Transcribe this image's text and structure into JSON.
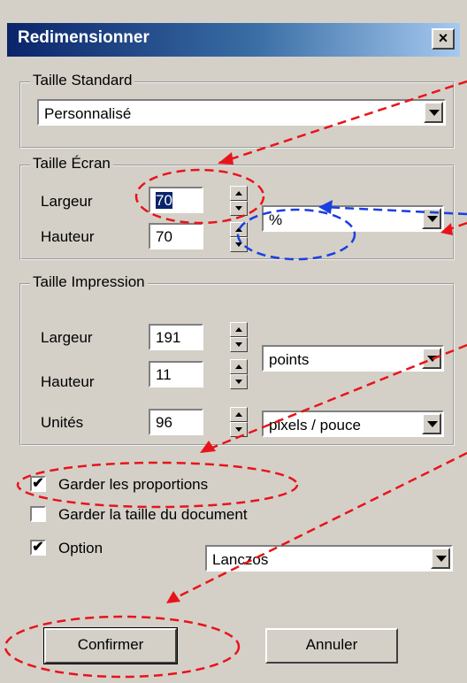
{
  "window": {
    "title": "Redimensionner",
    "close_label": "×"
  },
  "standard": {
    "legend": "Taille Standard",
    "select_value": "Personnalisé"
  },
  "screen": {
    "legend": "Taille Écran",
    "width_label": "Largeur",
    "width_value": "70",
    "height_label": "Hauteur",
    "height_value": "70",
    "unit_value": "%"
  },
  "print": {
    "legend": "Taille Impression",
    "width_label": "Largeur",
    "width_value": "191",
    "height_label": "Hauteur",
    "height_value": "11",
    "units_label": "Unités",
    "units_value": "96",
    "size_unit": "points",
    "res_unit": "pixels / pouce"
  },
  "options": {
    "keep_proportions": {
      "label": "Garder les proportions",
      "checked": true
    },
    "keep_doc_size": {
      "label": "Garder la taille du document",
      "checked": false
    },
    "option": {
      "label": "Option",
      "checked": true,
      "value": "Lanczos"
    }
  },
  "buttons": {
    "confirm": "Confirmer",
    "cancel": "Annuler"
  },
  "colors": {
    "annotation_red": "#e8141a",
    "annotation_blue": "#1a3fe0"
  }
}
